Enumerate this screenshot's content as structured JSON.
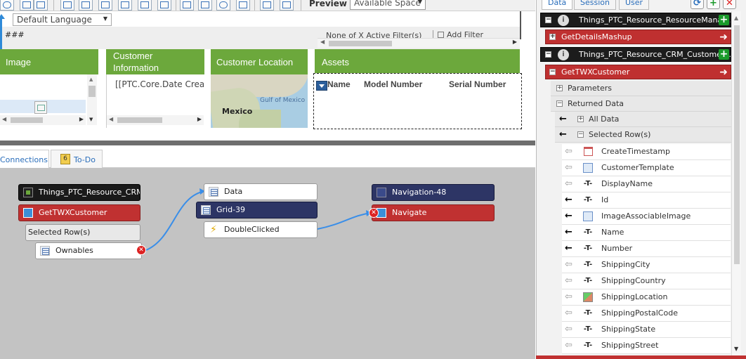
{
  "toolbar": {
    "preview_label": "Preview",
    "space_option": "Available Space"
  },
  "canvas": {
    "language_option": "Default Language",
    "hash_text": "###",
    "filter_status": "None of X Active Filter(s)",
    "add_filter_label": "Add Filter",
    "headers": {
      "image": "Image",
      "customer_information": "Customer Information",
      "customer_location": "Customer Location",
      "assets": "Assets"
    },
    "customer_cell": "[[PTC.Core.Date Created",
    "map_mexico": "Mexico",
    "map_gulf": "Gulf of Mexico",
    "asset_columns": [
      "Name",
      "Model Number",
      "Serial Number"
    ]
  },
  "bottom_tabs": {
    "connections": "Connections",
    "todo": "To-Do",
    "todo_count": "6"
  },
  "graph": {
    "thing_crm": "Things_PTC_Resource_CRM_...",
    "service_get_customer": "GetTWXCustomer",
    "selected_rows": "Selected Row(s)",
    "ownables": "Ownables",
    "data": "Data",
    "grid": "Grid-39",
    "double_clicked": "DoubleClicked",
    "navigation": "Navigation-48",
    "navigate": "Navigate",
    "colors": {
      "canvas_bg": "#c3c3c3",
      "link": "#3a8ee8",
      "service": "#c03131",
      "widget": "#2d3565",
      "thing": "#1a1a1a"
    }
  },
  "panel": {
    "tabs": {
      "data": "Data",
      "session": "Session",
      "user": "User"
    },
    "icons": {
      "refresh": "refresh-icon",
      "add": "add-icon",
      "close": "close-icon"
    },
    "sources": [
      {
        "thing": "Things_PTC_Resource_ResourceManag...",
        "services": [
          "GetDetailsMashup"
        ]
      },
      {
        "thing": "Things_PTC_Resource_CRM_Customer...",
        "services": [
          "GetTWXCustomer"
        ]
      }
    ],
    "tree": {
      "parameters": "Parameters",
      "returned_data": "Returned Data",
      "all_data": "All Data",
      "selected_rows": "Selected Row(s)"
    },
    "fields": [
      {
        "name": "CreateTimestamp",
        "type": "date-icon",
        "bound": false
      },
      {
        "name": "CustomerTemplate",
        "type": "template-icon",
        "bound": false
      },
      {
        "name": "DisplayName",
        "type": "string-icon",
        "bound": false
      },
      {
        "name": "Id",
        "type": "string-icon",
        "bound": true
      },
      {
        "name": "ImageAssociableImage",
        "type": "image-icon",
        "bound": true
      },
      {
        "name": "Name",
        "type": "string-icon",
        "bound": true
      },
      {
        "name": "Number",
        "type": "string-icon",
        "bound": true
      },
      {
        "name": "ShippingCity",
        "type": "string-icon",
        "bound": false
      },
      {
        "name": "ShippingCountry",
        "type": "string-icon",
        "bound": false
      },
      {
        "name": "ShippingLocation",
        "type": "location-icon",
        "bound": false
      },
      {
        "name": "ShippingPostalCode",
        "type": "string-icon",
        "bound": false
      },
      {
        "name": "ShippingState",
        "type": "string-icon",
        "bound": false
      },
      {
        "name": "ShippingStreet",
        "type": "string-icon",
        "bound": false
      }
    ],
    "type_glyph": "-T-"
  }
}
